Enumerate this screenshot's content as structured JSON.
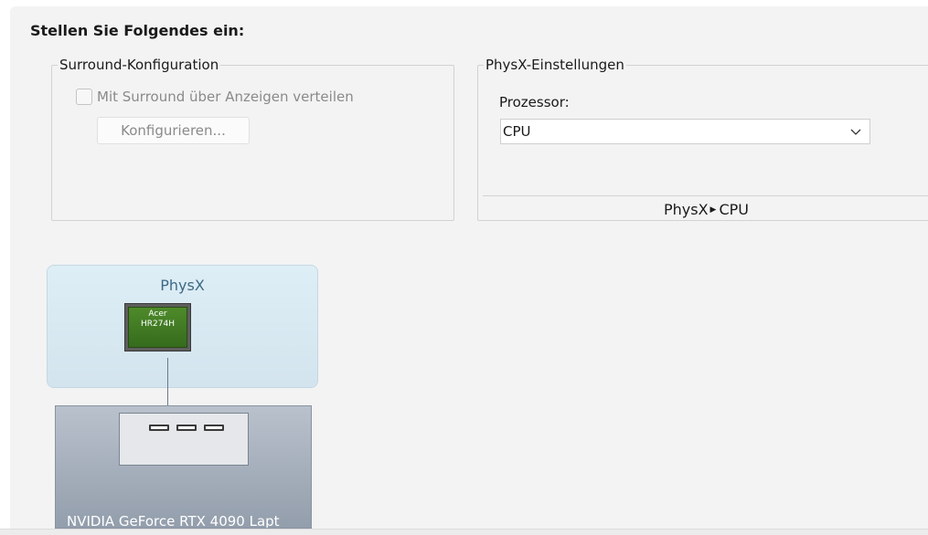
{
  "section_title": "Stellen Sie Folgendes ein:",
  "surround": {
    "legend": "Surround-Konfiguration",
    "checkbox_label": "Mit Surround über Anzeigen verteilen",
    "checked": false,
    "configure_button": "Konfigurieren..."
  },
  "physx": {
    "legend": "PhysX-Einstellungen",
    "processor_label": "Prozessor:",
    "processor_value": "CPU",
    "status_left": "PhysX",
    "status_right": "CPU"
  },
  "diagram": {
    "physx_label": "PhysX",
    "monitor_brand": "Acer",
    "monitor_model": "HR274H",
    "gpu_name": "NVIDIA GeForce RTX 4090 Lapt"
  },
  "colors": {
    "panel_bg": "#f3f3f3",
    "physx_box": "#deeef6",
    "monitor_screen": "#4e8a2a",
    "gpu_box": "#b9c1cc"
  }
}
